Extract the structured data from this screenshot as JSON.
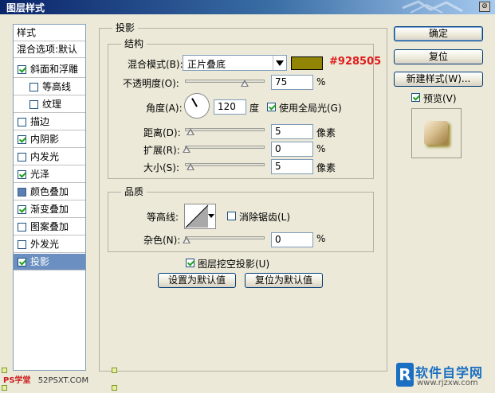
{
  "window": {
    "title": "图层样式",
    "close_glyph": "⊘"
  },
  "left_panel": {
    "header": "样式",
    "blend_options": "混合选项:默认",
    "items": [
      {
        "label": "斜面和浮雕",
        "checked": true
      },
      {
        "label": "等高线",
        "checked": false
      },
      {
        "label": "纹理",
        "checked": false
      },
      {
        "label": "描边",
        "checked": false
      },
      {
        "label": "内阴影",
        "checked": true
      },
      {
        "label": "内发光",
        "checked": false
      },
      {
        "label": "光泽",
        "checked": true
      },
      {
        "label": "颜色叠加",
        "checked": false
      },
      {
        "label": "渐变叠加",
        "checked": true
      },
      {
        "label": "图案叠加",
        "checked": false
      },
      {
        "label": "外发光",
        "checked": false
      },
      {
        "label": "投影",
        "checked": true
      }
    ]
  },
  "drop_shadow": {
    "title": "投影",
    "structure": {
      "title": "结构",
      "blend_mode_label": "混合模式(B):",
      "blend_mode_value": "正片叠底",
      "color_hex": "#928505",
      "color": "#928505",
      "opacity_label": "不透明度(O):",
      "opacity_value": "75",
      "opacity_unit": "%",
      "opacity_level": 0.75,
      "angle_label": "角度(A):",
      "angle_value": "120",
      "angle_unit": "度",
      "global_light_label": "使用全局光(G)",
      "global_light_checked": true,
      "distance_label": "距离(D):",
      "distance_value": "5",
      "distance_unit": "像素",
      "spread_label": "扩展(R):",
      "spread_value": "0",
      "spread_unit": "%",
      "size_label": "大小(S):",
      "size_value": "5",
      "size_unit": "像素"
    },
    "quality": {
      "title": "品质",
      "contour_label": "等高线:",
      "anti_alias_label": "消除锯齿(L)",
      "anti_alias_checked": false,
      "noise_label": "杂色(N):",
      "noise_value": "0",
      "noise_unit": "%"
    },
    "knockout_label": "图层挖空投影(U)",
    "knockout_checked": true,
    "make_default_label": "设置为默认值",
    "reset_default_label": "复位为默认值"
  },
  "buttons": {
    "ok": "确定",
    "reset": "复位",
    "new_style": "新建样式(W)...",
    "preview_label": "预览(V)",
    "preview_checked": true
  },
  "watermark_left": {
    "brand": "PS学堂",
    "url": "52PSXT.COM"
  },
  "watermark_right": {
    "logo": "R",
    "title": "软件自学网",
    "url": "www.rjzxw.com"
  }
}
